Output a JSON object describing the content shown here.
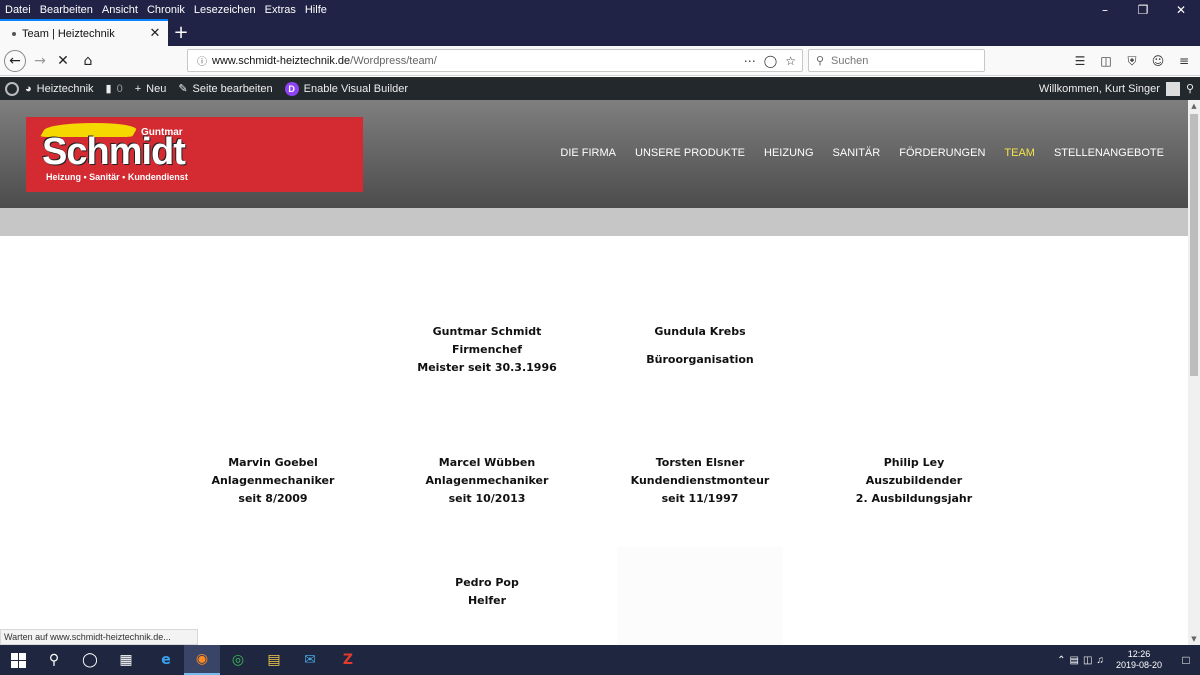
{
  "menubar": {
    "items": [
      "Datei",
      "Bearbeiten",
      "Ansicht",
      "Chronik",
      "Lesezeichen",
      "Extras",
      "Hilfe"
    ]
  },
  "tab": {
    "title": "Team | Heiztechnik"
  },
  "url": {
    "domain": "www.schmidt-heiztechnik.de",
    "path": "/Wordpress/team/"
  },
  "search": {
    "placeholder": "Suchen"
  },
  "wpbar": {
    "site": "Heiztechnik",
    "comments": "0",
    "new": "Neu",
    "edit": "Seite bearbeiten",
    "divi": "D",
    "builder": "Enable Visual Builder",
    "welcome": "Willkommen, Kurt Singer"
  },
  "logo": {
    "owner": "Guntmar",
    "brand": "Schmidt",
    "slogan": "Heizung • Sanitär • Kundendienst"
  },
  "nav": [
    "DIE FIRMA",
    "UNSERE PRODUKTE",
    "HEIZUNG",
    "SANITÄR",
    "FÖRDERUNGEN",
    "TEAM",
    "STELLENANGEBOTE"
  ],
  "team": [
    {
      "name": "Guntmar Schmidt",
      "role": "Firmenchef",
      "note": "Meister seit 30.3.1996"
    },
    {
      "name": "Gundula Krebs",
      "role": "Büroorganisation",
      "note": ""
    },
    {
      "name": "Marvin Goebel",
      "role": "Anlagenmechaniker",
      "note": "seit 8/2009"
    },
    {
      "name": "Marcel Wübben",
      "role": "Anlagenmechaniker",
      "note": "seit 10/2013"
    },
    {
      "name": "Torsten Elsner",
      "role": "Kundendienstmonteur",
      "note": "seit 11/1997"
    },
    {
      "name": "Philip Ley",
      "role": "Auszubildender",
      "note": "2. Ausbildungsjahr"
    },
    {
      "name": "Pedro Pop",
      "role": "Helfer",
      "note": ""
    }
  ],
  "status": "Warten auf www.schmidt-heiztechnik.de...",
  "clock": {
    "time": "12:26",
    "date": "2019-08-20"
  },
  "colors": {
    "accent": "#0a84ff",
    "nav_active": "#f3e24b",
    "logo_bg": "#d42b32",
    "wpbar": "#23282d"
  }
}
